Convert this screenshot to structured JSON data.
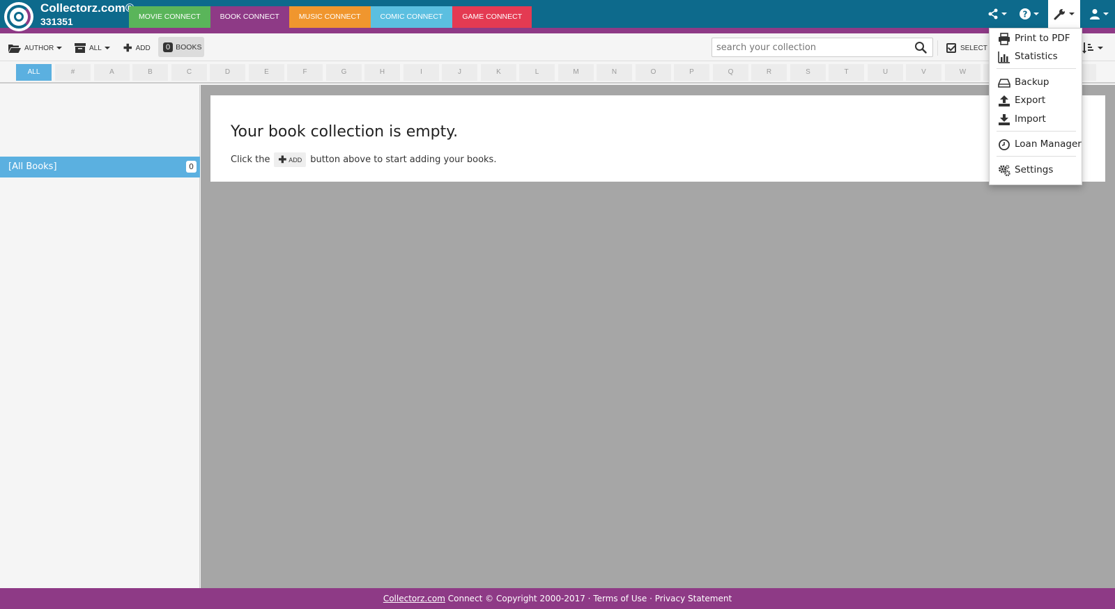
{
  "brand": {
    "name": "Collectorz.com®",
    "number": "331351"
  },
  "tabs": [
    {
      "label": "MOVIE CONNECT",
      "color": "#5ab55a"
    },
    {
      "label": "BOOK CONNECT",
      "color": "#8e3a86"
    },
    {
      "label": "MUSIC CONNECT",
      "color": "#f0962e"
    },
    {
      "label": "COMIC CONNECT",
      "color": "#5bbfe0"
    },
    {
      "label": "GAME CONNECT",
      "color": "#e43a52"
    }
  ],
  "top_icons": [
    "share-icon",
    "help-icon",
    "wrench-icon",
    "user-icon"
  ],
  "toolbar": {
    "author_label": "AUTHOR",
    "all_label": "ALL",
    "add_label": "ADD",
    "books_count": "0",
    "books_label": "BOOKS",
    "search_placeholder": "search your collection",
    "select_label": "SELECT"
  },
  "alphabet": [
    "ALL",
    "#",
    "A",
    "B",
    "C",
    "D",
    "E",
    "F",
    "G",
    "H",
    "I",
    "J",
    "K",
    "L",
    "M",
    "N",
    "O",
    "P",
    "Q",
    "R",
    "S",
    "T",
    "U",
    "V",
    "W"
  ],
  "sidebar": {
    "item_label": "[All Books]",
    "item_count": "0"
  },
  "main": {
    "empty_title": "Your book collection is empty.",
    "empty_text_before": "Click the",
    "empty_add_label": "ADD",
    "empty_text_after": "button above to start adding your books."
  },
  "footer": {
    "link": "Collectorz.com",
    "text": "Connect © Copyright 2000-2017 ·",
    "terms": "Terms of Use",
    "separator": "·",
    "privacy": "Privacy Statement"
  },
  "dropdown": {
    "print": "Print to PDF",
    "statistics": "Statistics",
    "backup": "Backup",
    "export": "Export",
    "import": "Import",
    "loan": "Loan Manager",
    "settings": "Settings"
  },
  "colors": {
    "topbar": "#0d6a8c",
    "purple": "#8e3a86",
    "active_blue": "#5bb0e0",
    "main_bg": "#a6a6a6"
  }
}
